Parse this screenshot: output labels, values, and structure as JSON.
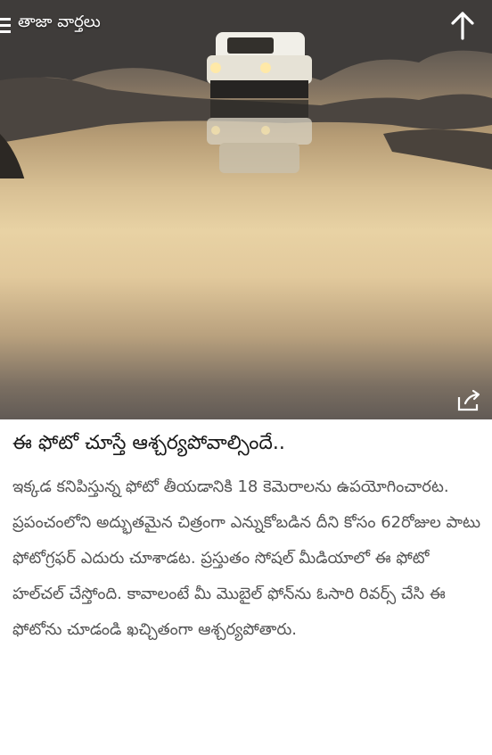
{
  "header": {
    "app_title": "తాజా వార్తలు"
  },
  "icons": {
    "menu": "menu-icon",
    "back_to_top": "arrow-up-icon",
    "share": "share-icon"
  },
  "article": {
    "headline": "ఈ ఫోటో చూస్తే ఆశ్చర్యపోవాల్సిందే..",
    "body": "ఇక్కడ కనిపిస్తున్న ఫోటో తీయడానికి 18 కెమెరాలను ఉపయోగించారట. ప్రపంచంలోని అద్భుతమైన చిత్రంగా ఎన్నుకోబడిన దీని కోసం 62రోజుల పాటు ఫోటోగ్రఫర్ ఎదురు చూశాడట. ప్రస్తుతం సోషల్ మీడియాలో ఈ ఫోటో హల్‌చల్ చేస్తోంది. కావాలంటే మీ మొబైల్ ఫోన్‌ను ఓసారి రివర్స్ చేసి ఈ ఫోటోను చూడండి ఖచ్చితంగా ఆశ్చర్యపోతారు."
  },
  "colors": {
    "headline": "#1a1a1a",
    "body": "#555555",
    "toolbar_text": "#ffffff"
  }
}
